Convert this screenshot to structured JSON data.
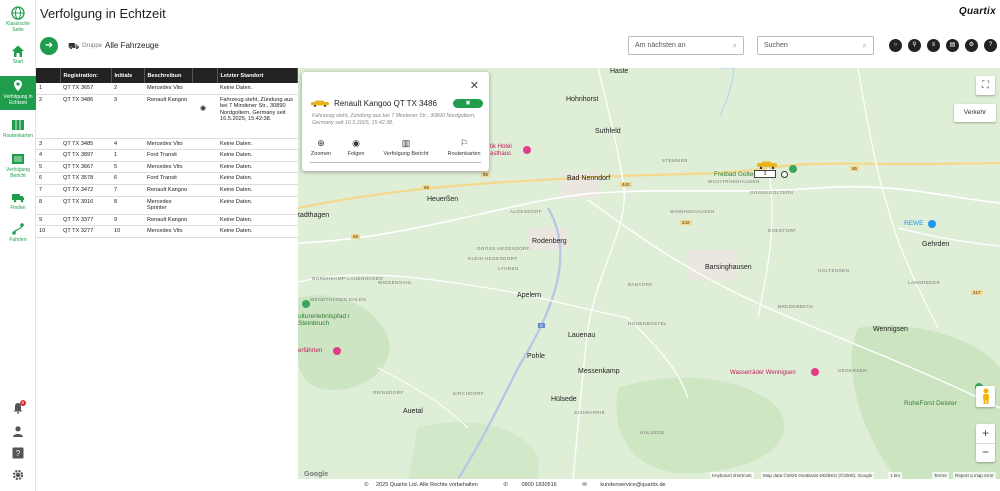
{
  "app": {
    "title": "Verfolgung in Echtzeit",
    "logo": "Quartix"
  },
  "sidebar": {
    "items": [
      {
        "label": "Klassische Seite"
      },
      {
        "label": "Start"
      },
      {
        "label": "Verfolgung in Echtzeit"
      },
      {
        "label": "Routenkarten"
      },
      {
        "label": "Verfolgung Bericht"
      },
      {
        "label": "Finden"
      },
      {
        "label": "Fahrten"
      }
    ],
    "notification_count": "5"
  },
  "toolbar": {
    "group_label": "Gruppe",
    "group_value": "Alle Fahrzeuge",
    "nearest_placeholder": "Am nächsten an",
    "search_placeholder": "Suchen",
    "help_label": "?"
  },
  "table": {
    "headers": [
      "",
      "Registration:",
      "Initials",
      "Beschreibun",
      "",
      "Letzter Standort"
    ],
    "rows": [
      {
        "num": "1",
        "reg": "QT TX 3657",
        "init": "2",
        "desc": "Mercedes Vito",
        "loc": "Keine Daten."
      },
      {
        "num": "2",
        "reg": "QT TX 3486",
        "init": "3",
        "desc": "Renault Kangoo",
        "loc": "Fahrzeug steht, Zündung aus bei 7 Mindener Str., 30890 Nordgoltern, Germany seit 16.5.2025, 15:42:38."
      },
      {
        "num": "3",
        "reg": "QT TX 3485",
        "init": "4",
        "desc": "Mercedes Vito",
        "loc": "Keine Daten."
      },
      {
        "num": "4",
        "reg": "QT TX 3897",
        "init": "1",
        "desc": "Ford Transit",
        "loc": "Keine Daten."
      },
      {
        "num": "5",
        "reg": "QT TX 3667",
        "init": "5",
        "desc": "Mercedes Vito",
        "loc": "Keine Daten."
      },
      {
        "num": "6",
        "reg": "QT TX 3578",
        "init": "6",
        "desc": "Ford Transit",
        "loc": "Keine Daten."
      },
      {
        "num": "7",
        "reg": "QT TX 3472",
        "init": "7",
        "desc": "Renault Kangoo",
        "loc": "Keine Daten."
      },
      {
        "num": "8",
        "reg": "QT TX 3916",
        "init": "8",
        "desc": "Mercedes Sprinter",
        "loc": "Keine Daten."
      },
      {
        "num": "9",
        "reg": "QT TX 3377",
        "init": "9",
        "desc": "Renault Kangoo",
        "loc": "Keine Daten."
      },
      {
        "num": "10",
        "reg": "QT TX 3277",
        "init": "10",
        "desc": "Mercedes Vito",
        "loc": "Keine Daten."
      }
    ]
  },
  "popup": {
    "vehicle_name": "Renault Kangoo QT TX 3486",
    "description": "Fahrzeug steht, Zündung aus bei 7 Mindener Str., 30890 Nordgoltern, Germany seit 16.5.2025, 15:42:38.",
    "actions": [
      "Zoomen",
      "Folgen",
      "Verfolgung Bericht",
      "Routenkarten"
    ]
  },
  "map": {
    "traffic_label": "Verkehr",
    "marker_label": "3",
    "places": {
      "haste": "Haste",
      "hohnhorst": "Hohnhorst",
      "suthfeld": "Suthfeld",
      "bad_nenndorf": "Bad Nenndorf",
      "heuerssen": "Heuerßen",
      "stadthagen": "tadthagen",
      "rodenberg": "Rodenberg",
      "barsinghausen": "Barsinghausen",
      "gehrden": "Gehrden",
      "rewe": "REWE",
      "apelern": "Apelern",
      "lauenau": "Lauenau",
      "pohle": "Pohle",
      "messenkamp": "Messenkamp",
      "wennigsen": "Wennigsen",
      "huelsede": "Hülsede",
      "auetal": "Auetal",
      "freibad": "Freibad Golte",
      "hotel": "tik Hotel asthaus",
      "wasserraeder": "Wasserräder Wennigsen",
      "ruheforst": "RuheForst Deister",
      "steinbruch": "ulturerlebnispfad r Steinbruch",
      "faehrten": "erfährten"
    },
    "small_places": {
      "stemmen": "STEMMEN",
      "wichtringhausen": "WICHTRINGHAUSEN",
      "grossgoltern": "GROSSGOLTERN",
      "winninghausen": "WINNINGHAUSEN",
      "algesdorf": "ALGESDORF",
      "gross_hegesdorf": "GROSS HEGESDORF",
      "klein_hegesdorf": "KLEIN HEGESDORF",
      "lyhren": "LYHREN",
      "nordhkamp": "NORDHKAMP-LAUENHAGEN",
      "wiedensahl": "WIEDENSAHL",
      "ahlen": "WENDTHAGEN EHLEN",
      "bredenbeck": "BREDENBECK",
      "raeuberweg": "REINSDORF",
      "kirchdorf": "KIRCHDORF",
      "schmarrie": "SCHMARRIE",
      "haus": "HÜLSEDE",
      "egestorf": "EGESTORF",
      "holtensen": "HOLTENSEN",
      "degersen": "DEGERSEN",
      "bantorf": "BANTORF",
      "hohenbostel": "HOHENBOSTEL",
      "langreder": "LANGREDER"
    },
    "roads": {
      "r65a": "65",
      "r65b": "65",
      "r65c": "65",
      "r65d": "65",
      "r442a": "442",
      "r442b": "442",
      "r2": "2",
      "r217": "217"
    },
    "attribution": {
      "google": "Google",
      "shortcuts": "Keyboard shortcuts",
      "data": "Map data ©2025 GeoBasis-DE/BKG (©2009), Google",
      "scale": "1 km",
      "terms": "Terms",
      "report": "Report a map error"
    }
  },
  "footer": {
    "copyright": "2025 Quartix Ltd. Alle Rechte vorbehalten",
    "phone": "0800 1830516",
    "email": "kundenservice@quartix.de"
  },
  "colors": {
    "accent": "#1f9d4c",
    "header_dark": "#222222",
    "map_bg": "#dfeed7"
  }
}
